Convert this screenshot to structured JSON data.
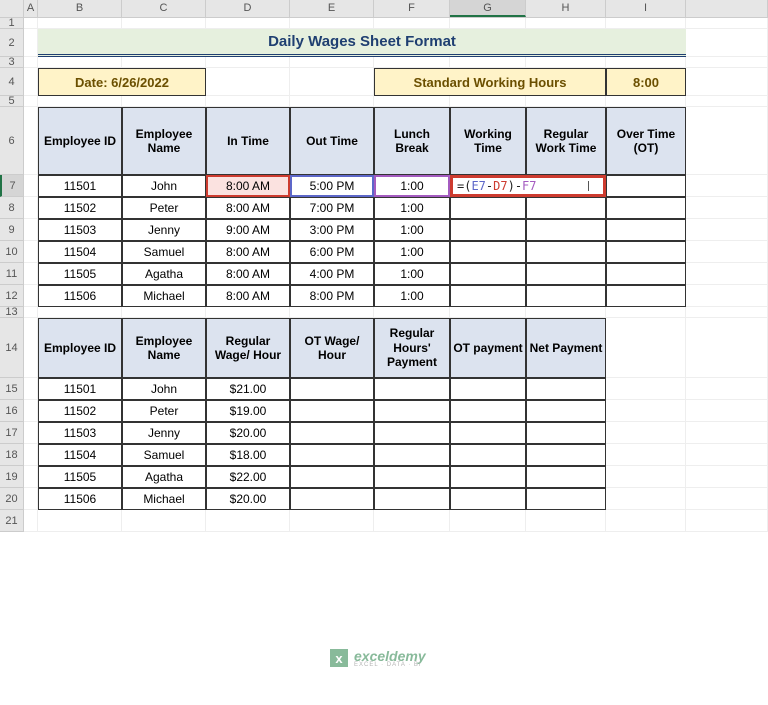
{
  "cols": [
    "A",
    "B",
    "C",
    "D",
    "E",
    "F",
    "G",
    "H",
    "I"
  ],
  "rows": [
    "1",
    "2",
    "3",
    "4",
    "5",
    "6",
    "7",
    "8",
    "9",
    "10",
    "11",
    "12",
    "13",
    "14",
    "15",
    "16",
    "17",
    "18",
    "19",
    "20",
    "21"
  ],
  "title": "Daily Wages Sheet Format",
  "date_label": "Date: 6/26/2022",
  "std_hours_label": "Standard Working Hours",
  "std_hours_value": "8:00",
  "table1": {
    "headers": [
      "Employee ID",
      "Employee Name",
      "In Time",
      "Out Time",
      "Lunch Break",
      "Working Time",
      "Regular Work Time",
      "Over Time (OT)"
    ],
    "rows": [
      {
        "id": "11501",
        "name": "John",
        "in": "8:00 AM",
        "out": "5:00 PM",
        "break": "1:00",
        "wt": "=(E7-D7)-F7"
      },
      {
        "id": "11502",
        "name": "Peter",
        "in": "8:00 AM",
        "out": "7:00 PM",
        "break": "1:00",
        "wt": ""
      },
      {
        "id": "11503",
        "name": "Jenny",
        "in": "9:00 AM",
        "out": "3:00 PM",
        "break": "1:00",
        "wt": ""
      },
      {
        "id": "11504",
        "name": "Samuel",
        "in": "8:00 AM",
        "out": "6:00 PM",
        "break": "1:00",
        "wt": ""
      },
      {
        "id": "11505",
        "name": "Agatha",
        "in": "8:00 AM",
        "out": "4:00 PM",
        "break": "1:00",
        "wt": ""
      },
      {
        "id": "11506",
        "name": "Michael",
        "in": "8:00 AM",
        "out": "8:00 PM",
        "break": "1:00",
        "wt": ""
      }
    ]
  },
  "table2": {
    "headers": [
      "Employee ID",
      "Employee Name",
      "Regular Wage/ Hour",
      "OT Wage/ Hour",
      "Regular Hours' Payment",
      "OT payment",
      "Net Payment"
    ],
    "rows": [
      {
        "id": "11501",
        "name": "John",
        "wage": "$21.00"
      },
      {
        "id": "11502",
        "name": "Peter",
        "wage": "$19.00"
      },
      {
        "id": "11503",
        "name": "Jenny",
        "wage": "$20.00"
      },
      {
        "id": "11504",
        "name": "Samuel",
        "wage": "$18.00"
      },
      {
        "id": "11505",
        "name": "Agatha",
        "wage": "$22.00"
      },
      {
        "id": "11506",
        "name": "Michael",
        "wage": "$20.00"
      }
    ]
  },
  "formula": {
    "eq": "=(",
    "e": "E7",
    "dash1": "-",
    "d": "D7",
    "close": ")-",
    "f": "F7"
  },
  "watermark": {
    "brand": "exceldemy",
    "sub": "EXCEL · DATA · BI"
  }
}
